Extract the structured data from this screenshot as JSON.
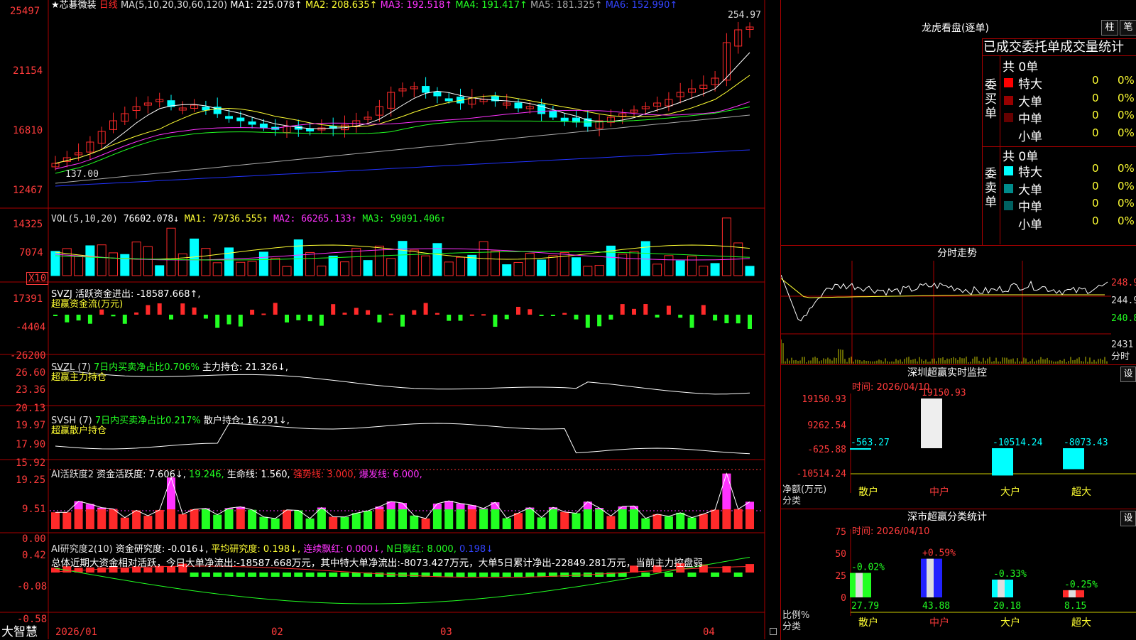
{
  "colors": {
    "up": "#ff2a2a",
    "down": "#00ffff",
    "green": "#22ff22",
    "magenta": "#ff33ff",
    "yellow": "#ffff33",
    "white": "#ffffff",
    "grey": "#aaaaaa",
    "blue": "#2222ff",
    "grid": "#aa0000"
  },
  "main": {
    "title_prefix": "★芯碁微装",
    "period": "日线",
    "ma_label": "MA(5,10,20,30,60,120)",
    "ma1": "MA1: 225.078↑",
    "ma2": "MA2: 208.635↑",
    "ma3": "MA3: 192.518↑",
    "ma4": "MA4: 191.417↑",
    "ma5": "MA5: 181.325↑",
    "ma6": "MA6: 152.990↑",
    "high_label": "254.97",
    "low_label": "137.00",
    "y_ticks": [
      "25497",
      "21154",
      "16810",
      "12467"
    ]
  },
  "vol": {
    "label": "VOL(5,10,20)",
    "v": "76602.078↓",
    "ma1": "MA1: 79736.555↑",
    "ma2": "MA2: 66265.133↑",
    "ma3": "MA3: 59091.406↑",
    "y_ticks": [
      "14325",
      "7074"
    ],
    "unit": "X10"
  },
  "svzj": {
    "label": "SVZJ  活跃资金进出: -18587.668↑,",
    "sub": "超赢资金流(万元)",
    "y_ticks": [
      "17391",
      "-4404",
      "-26200"
    ]
  },
  "svzl": {
    "label": "SVZL (7)",
    "ratio": "7日内买卖净占比0.706%",
    "hold": "主力持仓: 21.326↓,",
    "sub": "超赢主力持仓",
    "y_ticks": [
      "26.60",
      "23.36",
      "20.13"
    ]
  },
  "svsh": {
    "label": "SVSH (7)",
    "ratio": "7日内买卖净占比0.217%",
    "hold": "散户持仓: 16.291↓,",
    "sub": "超赢散户持仓",
    "y_ticks": [
      "19.97",
      "17.90",
      "15.92"
    ]
  },
  "ai1": {
    "label": "AI活跃度2",
    "a": "资金活跃度: 7.606↓,",
    "b": "19.246,",
    "c": "生命线: 1.560,",
    "d": "强势线: 3.000,",
    "e": "爆发线: 6.000,",
    "y_ticks": [
      "19.25",
      "9.51",
      "0.00"
    ]
  },
  "ai2": {
    "label": "AI研究度2(10)",
    "a": "资金研究度: -0.016↓,",
    "b": "平均研究度: 0.198↓,",
    "c": "连续飘红: 0.000↓,",
    "d": "N日飘红: 8.000,",
    "e": "0.198↓",
    "summary": "总体近期大资金相对活跃，今日大单净流出:-18587.668万元，其中特大单净流出:-8073.427万元，大单5日累计净出-22849.281万元，当前主力控盘弱",
    "y_ticks": [
      "0.42",
      "-0.08",
      "-0.58"
    ]
  },
  "bottom": {
    "brand": "大智慧",
    "dates": [
      "2026/01",
      "02",
      "03",
      "04"
    ]
  },
  "side": {
    "lhb_title": "龙虎看盘(逐单)",
    "btn_bar": "柱",
    "btn_pen": "笔",
    "header": "已成交委托单成交量统计",
    "buy_label": "委买单",
    "sell_label": "委卖单",
    "buy_total": "共 0单",
    "sell_total": "共 0单",
    "buy_rows": [
      {
        "name": "特大",
        "val": "0",
        "pct": "0%",
        "color": "#ff0000"
      },
      {
        "name": "大单",
        "val": "0",
        "pct": "0%",
        "color": "#990000"
      },
      {
        "name": "中单",
        "val": "0",
        "pct": "0%",
        "color": "#660000"
      },
      {
        "name": "小单",
        "val": "0",
        "pct": "0%",
        "color": "#000000"
      }
    ],
    "sell_rows": [
      {
        "name": "特大",
        "val": "0",
        "pct": "0%",
        "color": "#00ffff"
      },
      {
        "name": "大单",
        "val": "0",
        "pct": "0%",
        "color": "#008b8b"
      },
      {
        "name": "中单",
        "val": "0",
        "pct": "0%",
        "color": "#006060"
      },
      {
        "name": "小单",
        "val": "0",
        "pct": "0%",
        "color": "#000000"
      }
    ],
    "intraday_title": "分时走势",
    "intraday_ticks": [
      "248.9",
      "244.9",
      "240.8",
      "2431"
    ],
    "intraday_unit": "分时",
    "sz_title": "深圳超赢实时监控",
    "sz_time": "时间: 2026/04/10",
    "sz_set": "设",
    "sz_y_ticks": [
      "19150.93",
      "9262.54",
      "-625.88",
      "-10514.24"
    ],
    "sz_ylabel": "净额(万元)",
    "sz_xlabel": "分类",
    "sz_cats": [
      "散户",
      "中户",
      "大户",
      "超大"
    ],
    "sz_values": [
      -563.27,
      19150.93,
      -10514.24,
      -8073.43
    ],
    "sz_value_labels": [
      "-563.27",
      "19150.93",
      "-10514.24",
      "-8073.43"
    ],
    "cls_title": "深市超赢分类统计",
    "cls_time": "时间: 2026/04/10",
    "cls_set": "设",
    "cls_y_ticks": [
      "75",
      "50",
      "25",
      "0"
    ],
    "cls_ylabel": "比例%",
    "cls_xlabel": "分类",
    "cls_cats": [
      "散户",
      "中户",
      "大户",
      "超大"
    ],
    "cls_values": [
      27.79,
      43.88,
      20.18,
      8.15
    ],
    "cls_value_labels": [
      "27.79",
      "43.88",
      "20.18",
      "8.15"
    ],
    "cls_change_labels": [
      "-0.02%",
      "+0.59%",
      "-0.33%",
      "-0.25%"
    ]
  }
}
